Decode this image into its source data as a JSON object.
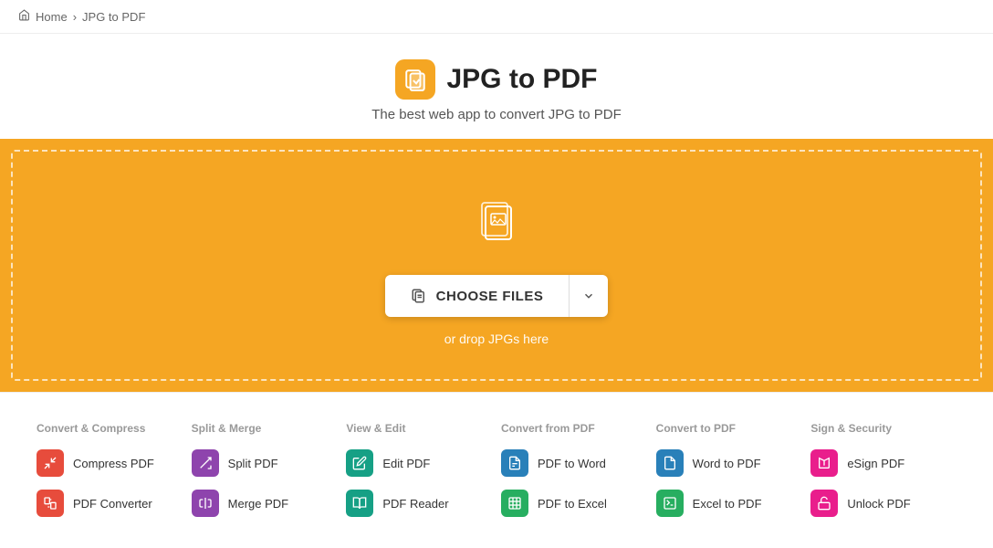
{
  "breadcrumb": {
    "home": "Home",
    "current": "JPG to PDF",
    "separator": "›"
  },
  "header": {
    "title": "JPG to PDF",
    "subtitle": "The best web app to convert JPG to PDF",
    "icon_label": "jpg-to-pdf-app-icon"
  },
  "dropzone": {
    "choose_label": "CHOOSE FILES",
    "hint": "or drop JPGs here"
  },
  "tools": {
    "categories": [
      {
        "title": "Convert & Compress",
        "items": [
          {
            "name": "Compress PDF",
            "icon_color": "ic-red"
          },
          {
            "name": "PDF Converter",
            "icon_color": "ic-red"
          }
        ]
      },
      {
        "title": "Split & Merge",
        "items": [
          {
            "name": "Split PDF",
            "icon_color": "ic-purple"
          },
          {
            "name": "Merge PDF",
            "icon_color": "ic-purple"
          }
        ]
      },
      {
        "title": "View & Edit",
        "items": [
          {
            "name": "Edit PDF",
            "icon_color": "ic-teal"
          },
          {
            "name": "PDF Reader",
            "icon_color": "ic-teal"
          }
        ]
      },
      {
        "title": "Convert from PDF",
        "items": [
          {
            "name": "PDF to Word",
            "icon_color": "ic-blue"
          },
          {
            "name": "PDF to Excel",
            "icon_color": "ic-green"
          }
        ]
      },
      {
        "title": "Convert to PDF",
        "items": [
          {
            "name": "Word to PDF",
            "icon_color": "ic-blue"
          },
          {
            "name": "Excel to PDF",
            "icon_color": "ic-green"
          }
        ]
      },
      {
        "title": "Sign & Security",
        "items": [
          {
            "name": "eSign PDF",
            "icon_color": "ic-pink"
          },
          {
            "name": "Unlock PDF",
            "icon_color": "ic-pink"
          }
        ]
      }
    ]
  }
}
